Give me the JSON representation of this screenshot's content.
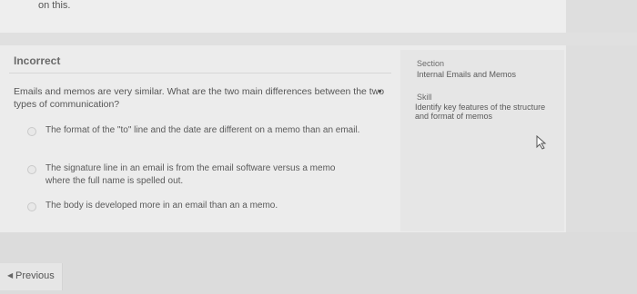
{
  "previous_question": {
    "trailing_text": "on this."
  },
  "result": {
    "status": "Incorrect"
  },
  "question": {
    "text": "Emails and memos are very similar. What are the two main differences between the two types of communication?",
    "choices": [
      {
        "text": "The format of the \"to\" line and the date are different on a memo than an email."
      },
      {
        "text": "The signature line in an email is from the email software versus a memo where the full name is spelled out."
      },
      {
        "text": "The body is developed more in an email than an a memo."
      }
    ]
  },
  "info_panel": {
    "section_label": "Section",
    "section_value": "Internal Emails and Memos",
    "skill_label": "Skill",
    "skill_value": "Identify key features of the structure and format of memos"
  },
  "navigation": {
    "previous_label": "Previous",
    "previous_icon": "triangle-left-icon"
  },
  "icons": {
    "cursor": "mouse-pointer-icon"
  },
  "colors": {
    "background": "#e4e4e4",
    "card": "#ececec",
    "text": "#555555"
  }
}
